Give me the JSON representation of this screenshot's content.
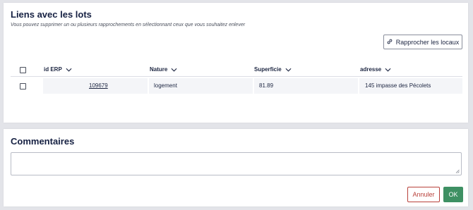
{
  "lots_section": {
    "title": "Liens avec les lots",
    "subtitle": "Vous pouvez supprimer un ou plusieurs rapprochements en sélectionnant ceux que vous souhaitez enlever",
    "rapprocher_button": "Rapprocher les locaux",
    "table": {
      "columns": [
        "id ERP",
        "Nature",
        "Superficie",
        "adresse"
      ],
      "rows": [
        {
          "id_erp": "109679",
          "nature": "logement",
          "superficie": "81.89",
          "adresse": "145 impasse des Pécolets",
          "selected": false
        }
      ]
    }
  },
  "comments_section": {
    "title": "Commentaires",
    "textarea_value": "",
    "cancel_button": "Annuler",
    "ok_button": "OK"
  },
  "colors": {
    "background": "#e3e4e9",
    "title": "#152042",
    "cancel": "#b8403a",
    "ok": "#3e9063"
  }
}
